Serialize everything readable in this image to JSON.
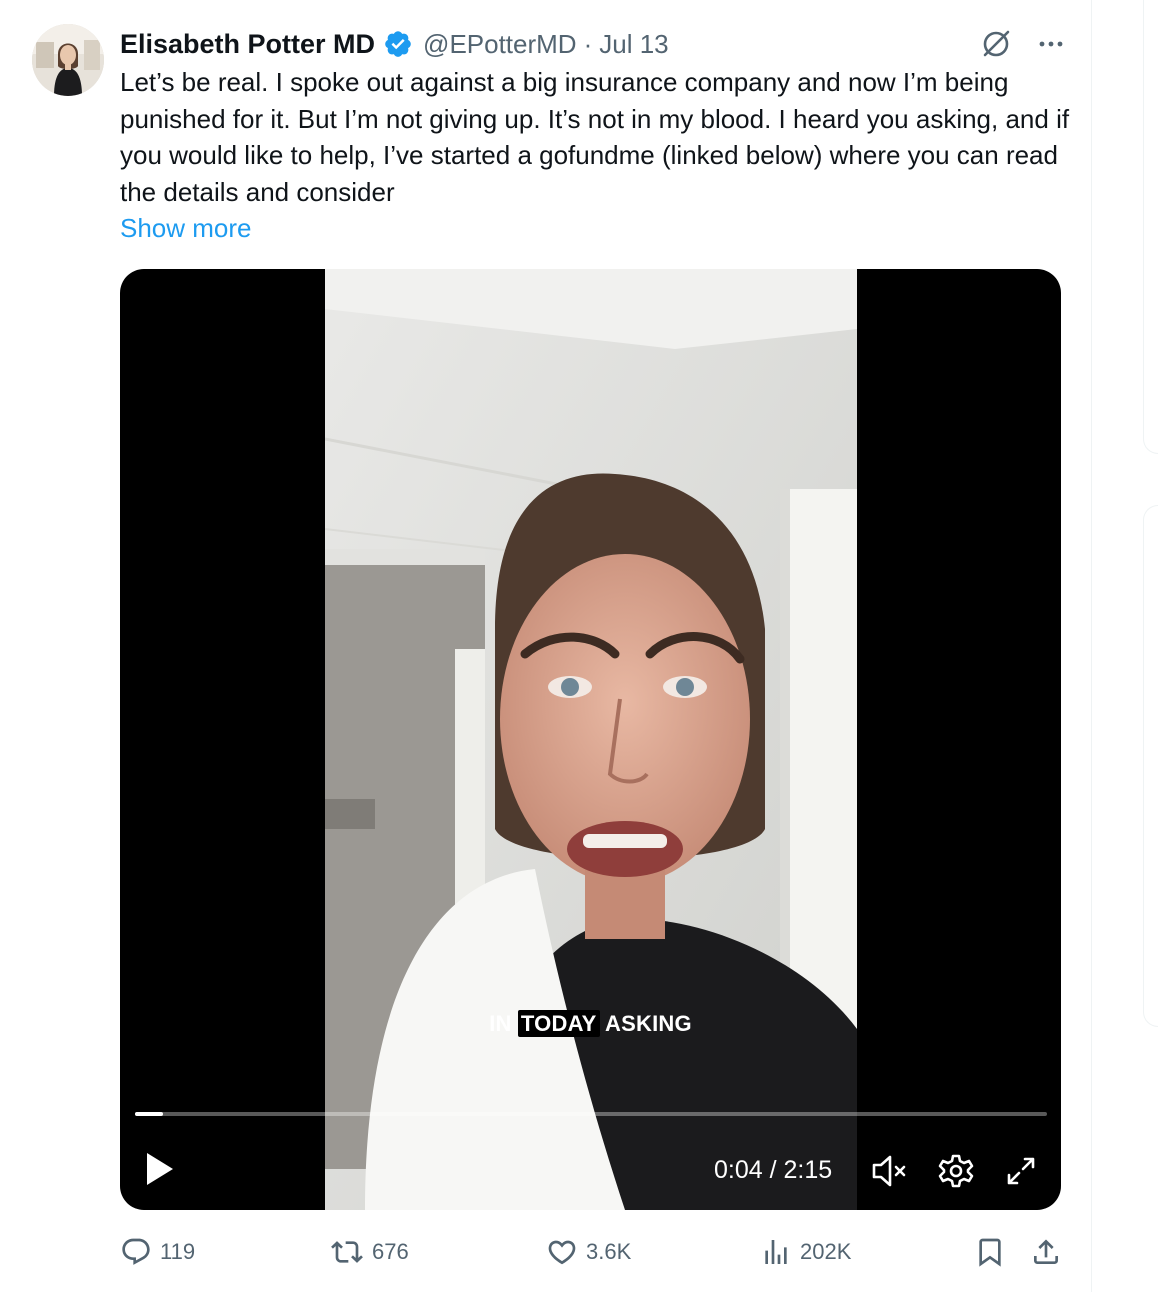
{
  "tweet": {
    "author_name": "Elisabeth Potter MD",
    "handle": "@EPotterMD",
    "separator": "·",
    "date": "Jul 13",
    "text": "Let’s be real. I spoke out against a big insurance company and now I’m being punished for it. But I’m not giving up. It’s not in my blood. I heard you asking, and if you would like to help, I’ve started a gofundme (linked below) where you can read the details and consider",
    "show_more": "Show more"
  },
  "video": {
    "caption_before": "IN",
    "caption_highlight": "TODAY",
    "caption_after": "ASKING",
    "current_time": "0:04",
    "time_separator": "/",
    "duration": "2:15",
    "progress_fraction": 0.031
  },
  "actions": {
    "replies": "119",
    "reposts": "676",
    "likes": "3.6K",
    "views": "202K"
  },
  "colors": {
    "link": "#1d9bf0",
    "verified": "#1d9bf0",
    "muted_text": "#536471"
  },
  "icons": [
    "grok-icon",
    "more-icon",
    "verified-badge-icon",
    "play-icon",
    "mute-icon",
    "settings-icon",
    "fullscreen-icon",
    "reply-icon",
    "repost-icon",
    "like-icon",
    "views-icon",
    "bookmark-icon",
    "share-icon"
  ]
}
